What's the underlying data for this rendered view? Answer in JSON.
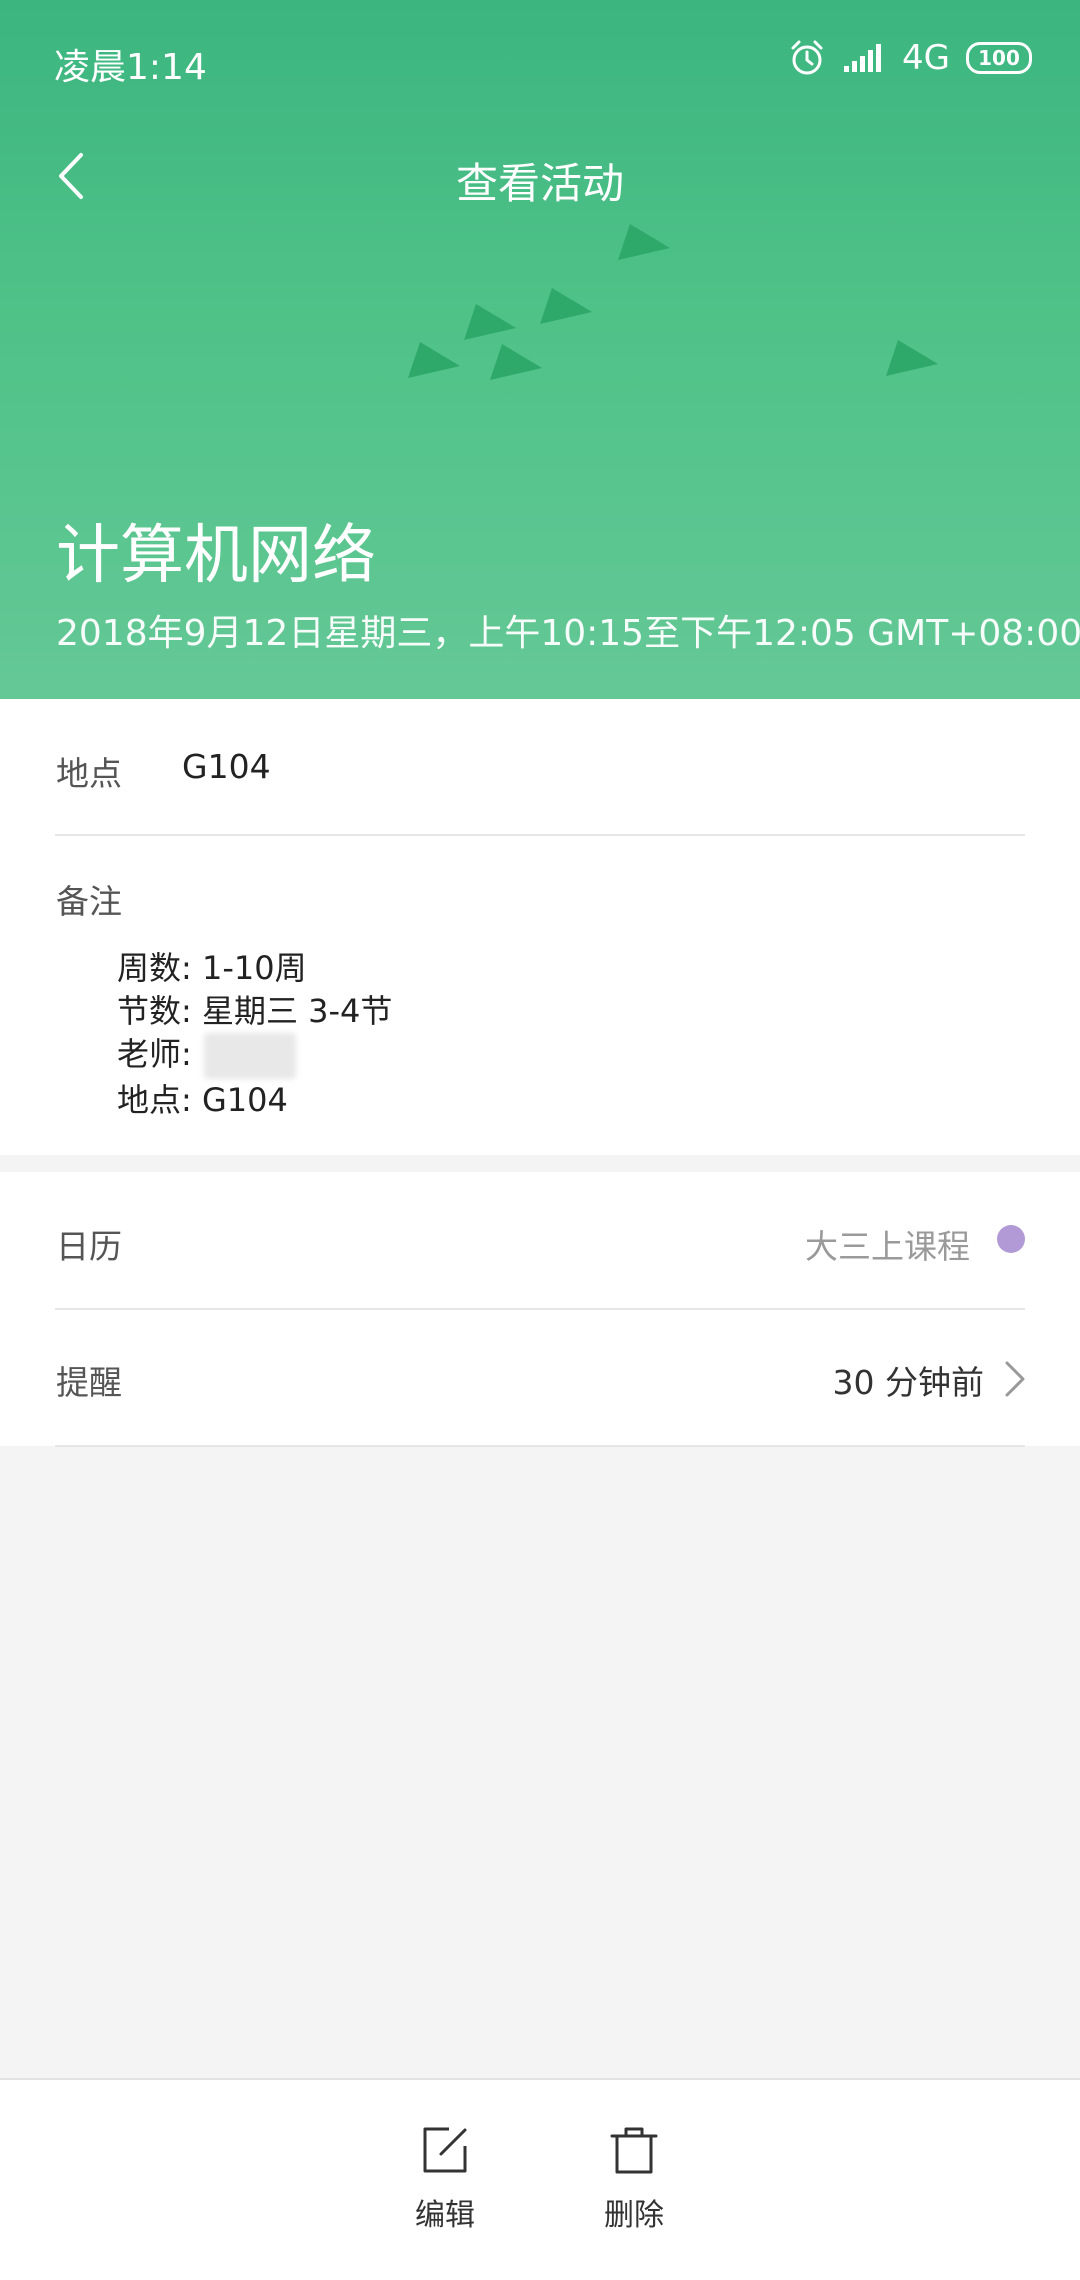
{
  "status_bar": {
    "time": "凌晨1:14",
    "network": "4G",
    "battery": "100"
  },
  "header": {
    "title": "查看活动",
    "event_title": "计算机网络",
    "event_time": "2018年9月12日星期三，上午10:15至下午12:05  GMT+08:00",
    "background_color": "#4fc288"
  },
  "details": {
    "location_label": "地点",
    "location_value": "G104",
    "notes_label": "备注",
    "notes": [
      "周数: 1-10周",
      "节数: 星期三 3-4节",
      "老师:",
      "地点: G104"
    ]
  },
  "settings": {
    "calendar_label": "日历",
    "calendar_value": "大三上课程",
    "calendar_color": "#b19ad6",
    "reminder_label": "提醒",
    "reminder_value": "30 分钟前"
  },
  "actions": {
    "edit_label": "编辑",
    "delete_label": "删除"
  },
  "icons": [
    "back-icon",
    "alarm-icon",
    "signal-icon",
    "battery-icon",
    "chevron-right-icon",
    "edit-icon",
    "trash-icon",
    "paper-plane-icon"
  ]
}
